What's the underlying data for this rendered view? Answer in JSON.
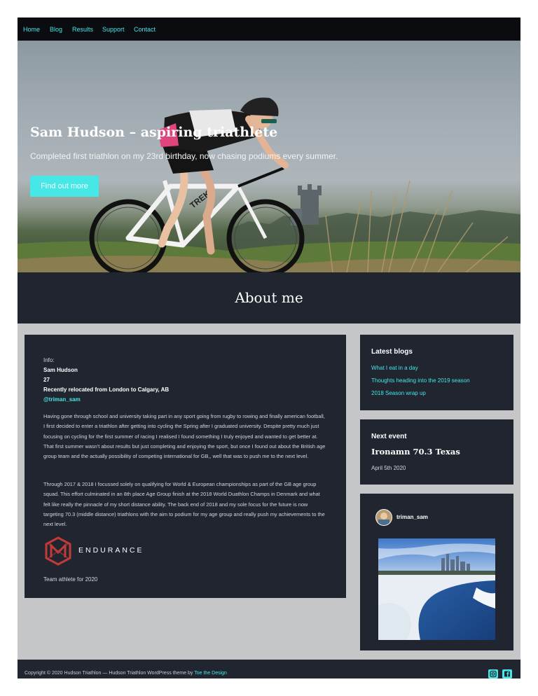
{
  "nav": {
    "items": [
      "Home",
      "Blog",
      "Results",
      "Support",
      "Contact"
    ]
  },
  "hero": {
    "title": "Sam Hudson – aspiring triathlete",
    "subtitle": "Completed first triathlon on my 23rd birthday, now chasing podiums every summer.",
    "cta": "Find out more",
    "bike_brand": "TREK"
  },
  "about": {
    "heading": "About me",
    "info_label": "Info:",
    "name": "Sam Hudson",
    "age": "27",
    "location": "Recently relocated from London to Calgary, AB",
    "twitter": "@triman_sam",
    "para1": "Having gone through school and university taking part in any sport going from rugby to rowing and finally american football, I first decided to enter a triathlon after getting into cycling the Spring after I graduated university. Despite pretty much just focusing on cycling for the first summer of racing I realised I found something I truly enjoyed and wanted to get better at. That first summer wasn't about results but just completing and enjoying the sport, but once I found out about the British age group team and the actually possibility of competing international for GB,, well that was to push me to the next level.",
    "para2": "Through 2017 & 2018 I focussed solely on qualifying for World & European championships as part of the GB age group squad. This effort culminated in an 8th place Age Group finish at the 2018 World Duathlon Champs in Denmark and what felt like really the pinnacle of my short distance ability. The back end of 2018 and my sole focus for the future is now targeting 70.3 (middle distance) triathlons with the aim to podium for my age group and really push my achievements to the next level.",
    "sponsor_logo": "ENDURANCE",
    "sponsor_caption": "Team athlete for 2020"
  },
  "sidebar": {
    "blogs_title": "Latest blogs",
    "blogs": [
      "What I eat in a day",
      "Thoughts heading into the 2019 season",
      "2018 Season wrap up"
    ],
    "event_heading": "Next event",
    "event_title": "Ironamn 70.3 Texas",
    "event_date": "April 5th 2020",
    "instagram_user": "triman_sam"
  },
  "footer": {
    "copyright": "Copyright © 2020 Hudson Triathlon — Hudson Triathlon WordPress theme by ",
    "theme_link": "Toe the Design",
    "social": [
      "instagram-icon",
      "facebook-icon"
    ]
  },
  "colors": {
    "accent": "#46e7e7",
    "dark": "#20252f",
    "nav": "#0b0c10",
    "page_bg": "#c4c6c8"
  }
}
